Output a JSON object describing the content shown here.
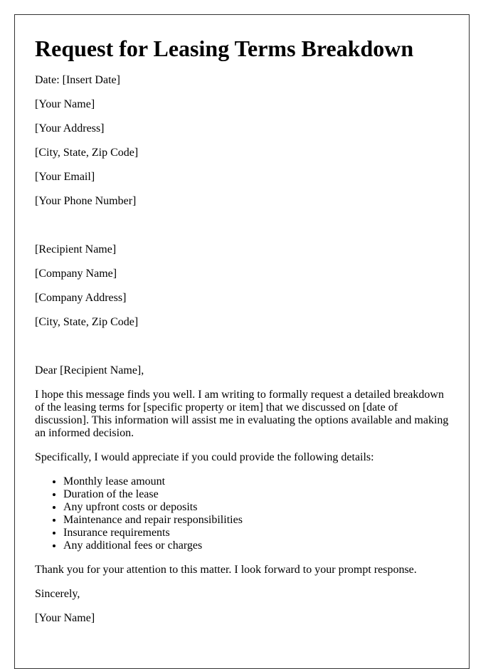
{
  "letter": {
    "title": "Request for Leasing Terms Breakdown",
    "sender": {
      "date": "Date: [Insert Date]",
      "name": "[Your Name]",
      "address": "[Your Address]",
      "city_state_zip": "[City, State, Zip Code]",
      "email": "[Your Email]",
      "phone": "[Your Phone Number]"
    },
    "recipient": {
      "name": "[Recipient Name]",
      "company": "[Company Name]",
      "company_address": "[Company Address]",
      "city_state_zip": "[City, State, Zip Code]"
    },
    "salutation": "Dear [Recipient Name],",
    "body_intro": "I hope this message finds you well. I am writing to formally request a detailed breakdown of the leasing terms for [specific property or item] that we discussed on [date of discussion]. This information will assist me in evaluating the options available and making an informed decision.",
    "list_intro": "Specifically, I would appreciate if you could provide the following details:",
    "details": [
      "Monthly lease amount",
      "Duration of the lease",
      "Any upfront costs or deposits",
      "Maintenance and repair responsibilities",
      "Insurance requirements",
      "Any additional fees or charges"
    ],
    "closing_text": "Thank you for your attention to this matter. I look forward to your prompt response.",
    "sign_off": "Sincerely,",
    "signature": "[Your Name]"
  }
}
